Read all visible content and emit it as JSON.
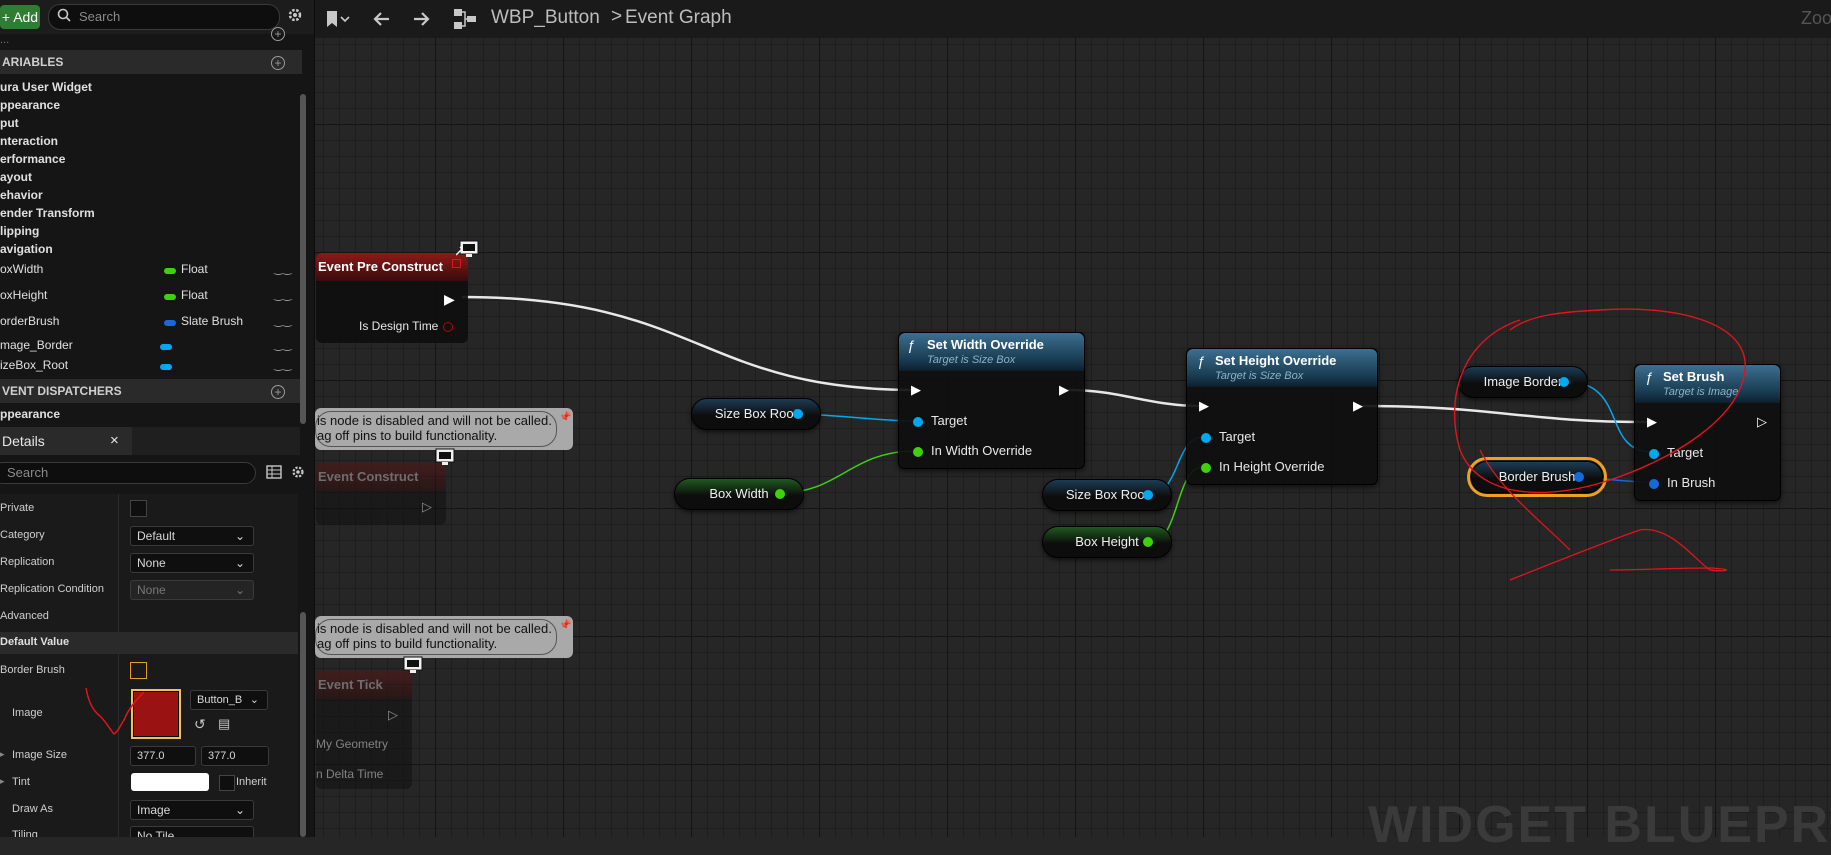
{
  "left_panel": {
    "add_label": "Add",
    "search_placeholder": "Search",
    "clipped_header": "...",
    "variables_header": "ARIABLES",
    "categories": [
      "ura User Widget",
      "ppearance",
      "put",
      "nteraction",
      "erformance",
      "ayout",
      "ehavior",
      "ender Transform",
      "lipping",
      "avigation"
    ],
    "variables": [
      {
        "name": "oxWidth",
        "type": "Float",
        "type_color": "#3ed10c"
      },
      {
        "name": "oxHeight",
        "type": "Float",
        "type_color": "#3ed10c"
      },
      {
        "name": "orderBrush",
        "type": "Slate Brush",
        "type_color": "#1569d8"
      },
      {
        "name": "mage_Border",
        "type": "",
        "type_color": "#00a8f0"
      },
      {
        "name": "izeBox_Root",
        "type": "",
        "type_color": "#00a8f0"
      }
    ],
    "dispatchers_header": "VENT DISPATCHERS",
    "dispatcher_item": "ppearance"
  },
  "details": {
    "tab_label": "Details",
    "close": "×",
    "search_placeholder": "Search",
    "private_label": "Private",
    "category_label": "Category",
    "category_value": "Default",
    "replication_label": "Replication",
    "replication_value": "None",
    "replication_condition_label": "Replication Condition",
    "replication_condition_value": "None",
    "advanced_label": "Advanced",
    "default_value_header": "Default Value",
    "border_brush_label": "Border Brush",
    "image_label": "Image",
    "image_value": "Button_B",
    "image_size_label": "Image Size",
    "image_size_x": "377.0",
    "image_size_y": "377.0",
    "tint_label": "Tint",
    "inherit_label": "Inherit",
    "draw_as_label": "Draw As",
    "draw_as_value": "Image",
    "tiling_label": "Tiling",
    "tiling_value": "No Tile"
  },
  "toolbar": {
    "blueprint_name": "WBP_Button",
    "separator": ">",
    "graph_name": "Event Graph",
    "zoom": "Zoo"
  },
  "graph": {
    "event_pre_construct": {
      "title": "Event Pre Construct",
      "pin": "Is Design Time"
    },
    "comment_text": [
      "is node is disabled and will not be called.",
      "ag off pins to build functionality."
    ],
    "event_construct": "Event Construct",
    "event_tick": {
      "title": "Event Tick",
      "pins": [
        "My Geometry",
        "n Delta Time"
      ]
    },
    "set_width": {
      "title": "Set Width Override",
      "subtitle": "Target is Size Box",
      "pins": [
        "Target",
        "In Width Override"
      ]
    },
    "set_height": {
      "title": "Set Height Override",
      "subtitle": "Target is Size Box",
      "pins": [
        "Target",
        "In Height Override"
      ]
    },
    "set_brush": {
      "title": "Set Brush",
      "subtitle": "Target is Image",
      "pins": [
        "Target",
        "In Brush"
      ]
    },
    "vars": {
      "size_box_root_1": "Size Box Root",
      "box_width": "Box Width",
      "size_box_root_2": "Size Box Root",
      "box_height": "Box Height",
      "image_border": "Image Border",
      "border_brush": "Border Brush"
    },
    "watermark": "WIDGET BLUEPRIN",
    "annotation_color": "#e0141e"
  }
}
